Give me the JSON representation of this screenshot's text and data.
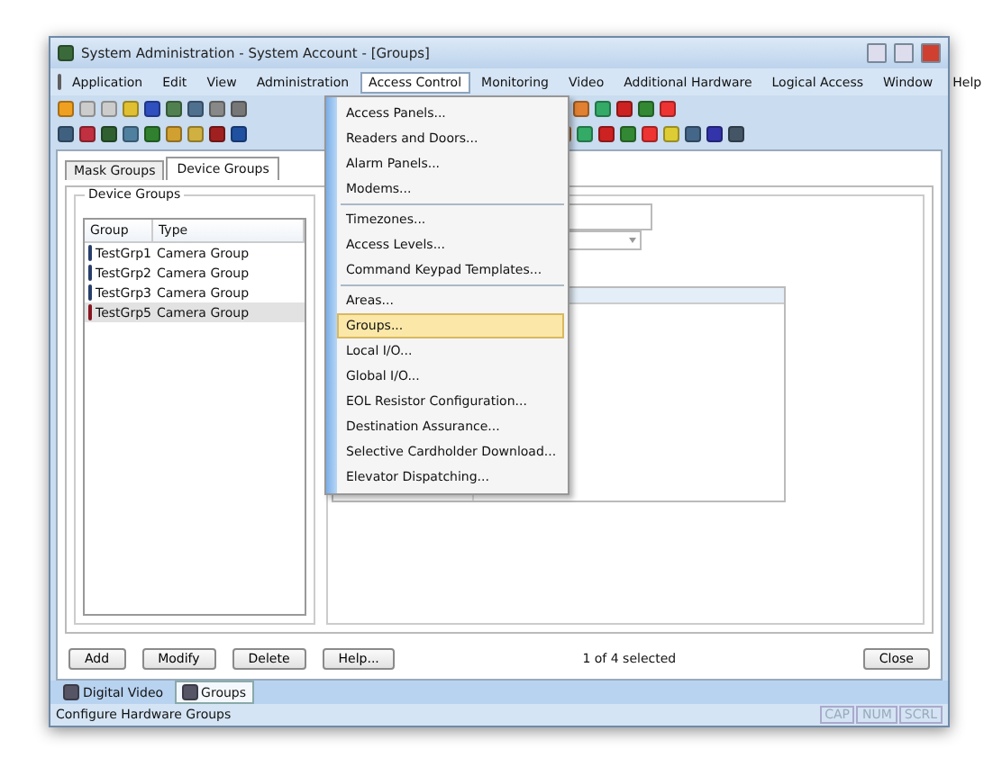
{
  "window": {
    "title": "System Administration - System Account - [Groups]"
  },
  "menu_bar": [
    {
      "label": "Application",
      "selected": false
    },
    {
      "label": "Edit",
      "selected": false
    },
    {
      "label": "View",
      "selected": false
    },
    {
      "label": "Administration",
      "selected": false
    },
    {
      "label": "Access Control",
      "selected": true
    },
    {
      "label": "Monitoring",
      "selected": false
    },
    {
      "label": "Video",
      "selected": false
    },
    {
      "label": "Additional Hardware",
      "selected": false
    },
    {
      "label": "Logical Access",
      "selected": false
    },
    {
      "label": "Window",
      "selected": false
    },
    {
      "label": "Help",
      "selected": false
    }
  ],
  "dropdown_menu": [
    {
      "label": "Access Panels...",
      "selected": false,
      "separator_after": false
    },
    {
      "label": "Readers and Doors...",
      "selected": false,
      "separator_after": false
    },
    {
      "label": "Alarm Panels...",
      "selected": false,
      "separator_after": false
    },
    {
      "label": "Modems...",
      "selected": false,
      "separator_after": true
    },
    {
      "label": "Timezones...",
      "selected": false,
      "separator_after": false
    },
    {
      "label": "Access Levels...",
      "selected": false,
      "separator_after": false
    },
    {
      "label": "Command Keypad Templates...",
      "selected": false,
      "separator_after": true
    },
    {
      "label": "Areas...",
      "selected": false,
      "separator_after": false
    },
    {
      "label": "Groups...",
      "selected": true,
      "separator_after": false
    },
    {
      "label": "Local I/O...",
      "selected": false,
      "separator_after": false
    },
    {
      "label": "Global I/O...",
      "selected": false,
      "separator_after": false
    },
    {
      "label": "EOL Resistor Configuration...",
      "selected": false,
      "separator_after": false
    },
    {
      "label": "Destination Assurance...",
      "selected": false,
      "separator_after": false
    },
    {
      "label": "Selective Cardholder Download...",
      "selected": false,
      "separator_after": false
    },
    {
      "label": "Elevator Dispatching...",
      "selected": false,
      "separator_after": false
    }
  ],
  "tabs": [
    {
      "label": "Mask Groups",
      "selected": false
    },
    {
      "label": "Device Groups",
      "selected": true
    }
  ],
  "group_box": {
    "title": "Device Groups"
  },
  "table": {
    "columns": [
      "Group",
      "Type"
    ],
    "rows": [
      {
        "group": "TestGrp1",
        "type": "Camera Group",
        "selected": false
      },
      {
        "group": "TestGrp2",
        "type": "Camera Group",
        "selected": false
      },
      {
        "group": "TestGrp3",
        "type": "Camera Group",
        "selected": false
      },
      {
        "group": "TestGrp5",
        "type": "Camera Group",
        "selected": true
      }
    ]
  },
  "buttons": [
    "Add",
    "Modify",
    "Delete",
    "Help..."
  ],
  "selection_count": "1 of 4 selected",
  "close_button": "Close",
  "window_tabs": [
    {
      "label": "Digital Video",
      "selected": false
    },
    {
      "label": "Groups",
      "selected": true
    }
  ],
  "status_bar": {
    "text": "Configure Hardware Groups",
    "indicators": [
      {
        "label": "CAP",
        "on": false
      },
      {
        "label": "NUM",
        "on": false
      },
      {
        "label": "SCRL",
        "on": false
      }
    ]
  }
}
